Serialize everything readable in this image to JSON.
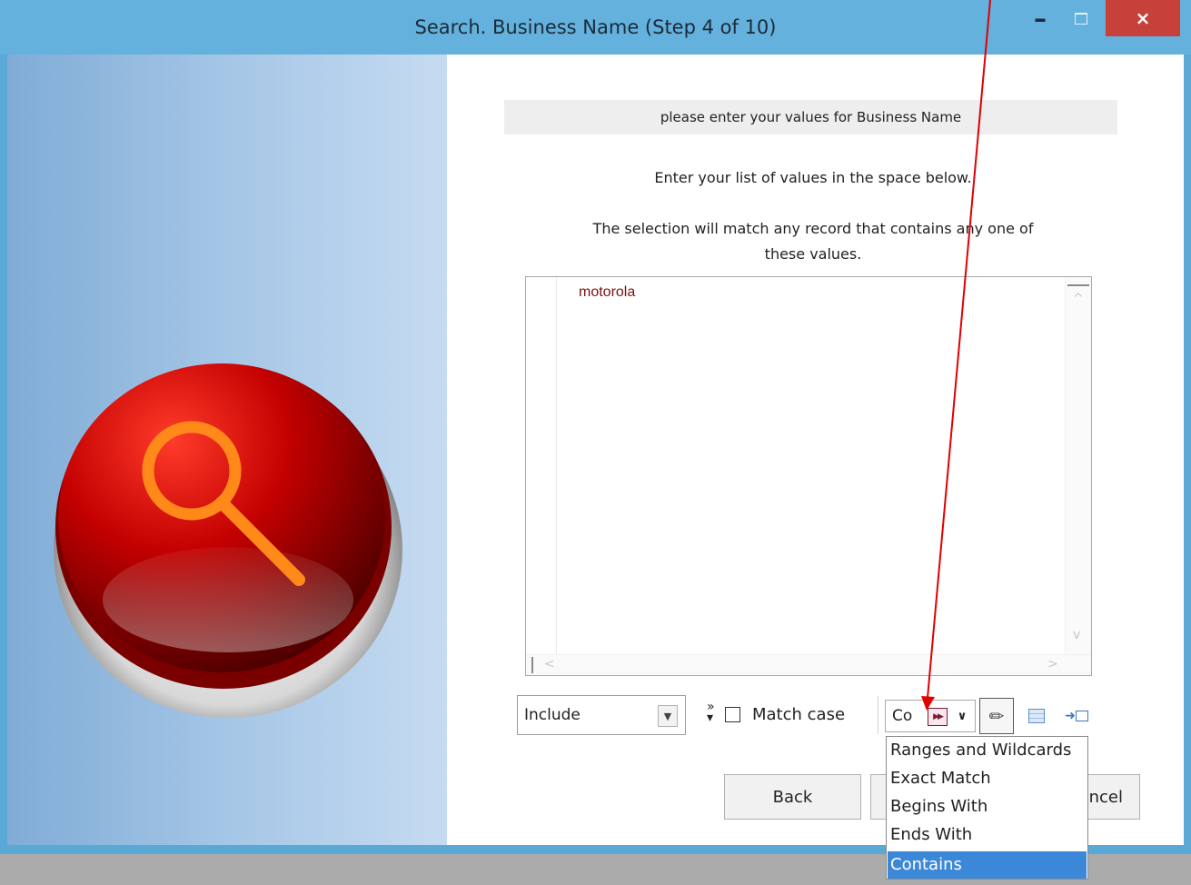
{
  "window": {
    "title": "Search.  Business Name (Step 4 of 10)",
    "minimize_glyph": "–",
    "close_glyph": "×"
  },
  "prompt": {
    "header": "please enter your values for Business Name",
    "instruction_1": "Enter your list of values in the space below.",
    "instruction_2a": "The selection will match any record that contains any one of",
    "instruction_2b": "these values."
  },
  "values_box": {
    "value": "motorola"
  },
  "options": {
    "include_select": "Include",
    "match_case_label": "Match case",
    "match_case_checked": false,
    "match_type_current": "Co"
  },
  "match_type_dropdown": {
    "options": [
      "Ranges and Wildcards",
      "Exact Match",
      "Begins With",
      "Ends With",
      "Contains"
    ],
    "selected": "Contains"
  },
  "buttons": {
    "back": "Back",
    "cancel": "ncel"
  },
  "colors": {
    "titlebar": "#63b1dc",
    "close_button": "#c7413a",
    "value_text": "#7a1010",
    "selection": "#3c88d8",
    "annotation_arrow": "#e00000"
  },
  "icons": {
    "search_button": "magnifier-icon",
    "pencil": "pencil-icon",
    "grid": "grid-icon",
    "to_column": "arrow-to-column-icon"
  }
}
